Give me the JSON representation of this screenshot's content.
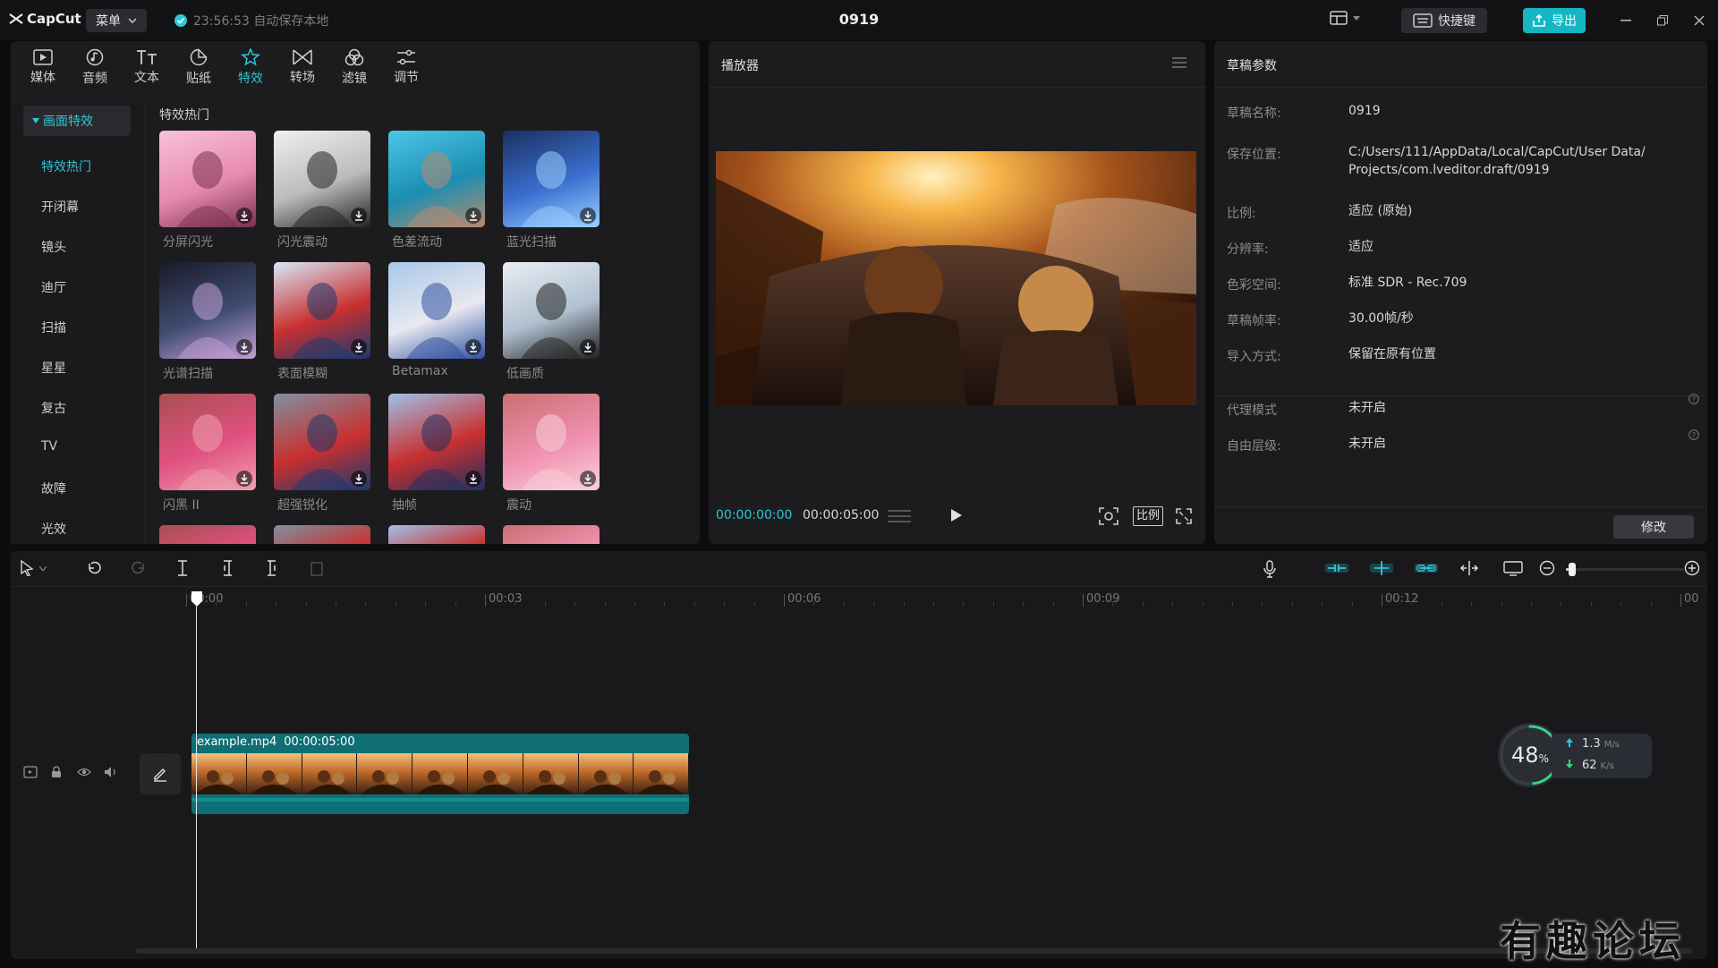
{
  "titlebar": {
    "app_name": "CapCut",
    "menu_label": "菜单",
    "autosave_text": "23:56:53 自动保存本地",
    "doc_title": "0919",
    "shortcut_label": "快捷键",
    "export_label": "导出"
  },
  "toolbar": [
    {
      "label": "媒体",
      "icon": "media-icon"
    },
    {
      "label": "音频",
      "icon": "audio-icon"
    },
    {
      "label": "文本",
      "icon": "text-icon"
    },
    {
      "label": "贴纸",
      "icon": "sticker-icon"
    },
    {
      "label": "特效",
      "icon": "effects-icon",
      "active": true
    },
    {
      "label": "转场",
      "icon": "transition-icon"
    },
    {
      "label": "滤镜",
      "icon": "filter-icon"
    },
    {
      "label": "调节",
      "icon": "adjust-icon"
    }
  ],
  "categories": {
    "header": "画面特效",
    "items": [
      "特效热门",
      "开闭幕",
      "镜头",
      "迪厅",
      "扫描",
      "星星",
      "复古",
      "TV",
      "故障",
      "光效"
    ]
  },
  "effects": {
    "section_title": "特效热门",
    "items": [
      {
        "label": "分屏闪光"
      },
      {
        "label": "闪光震动"
      },
      {
        "label": "色差流动"
      },
      {
        "label": "蓝光扫描"
      },
      {
        "label": "光谱扫描"
      },
      {
        "label": "表面模糊"
      },
      {
        "label": "Betamax"
      },
      {
        "label": "低画质"
      },
      {
        "label": "闪黑 II"
      },
      {
        "label": "超强锐化"
      },
      {
        "label": "抽帧"
      },
      {
        "label": "震动"
      }
    ]
  },
  "player": {
    "title": "播放器",
    "current_time": "00:00:00:00",
    "total_time": "00:00:05:00",
    "ratio_label": "比例"
  },
  "params": {
    "title": "草稿参数",
    "rows": [
      {
        "label": "草稿名称:",
        "value": "0919"
      },
      {
        "label": "保存位置:",
        "value": "C:/Users/111/AppData/Local/CapCut/User Data/",
        "value2": "Projects/com.lveditor.draft/0919"
      },
      {
        "label": "比例:",
        "value": "适应 (原始)"
      },
      {
        "label": "分辨率:",
        "value": "适应"
      },
      {
        "label": "色彩空间:",
        "value": "标准 SDR - Rec.709"
      },
      {
        "label": "草稿帧率:",
        "value": "30.00帧/秒"
      },
      {
        "label": "导入方式:",
        "value": "保留在原有位置"
      },
      {
        "label": "代理模式",
        "value": "未开启"
      },
      {
        "label": "自由层级:",
        "value": "未开启"
      }
    ],
    "modify_label": "修改"
  },
  "timeline": {
    "ruler": [
      "00:00",
      "00:03",
      "00:06",
      "00:09",
      "00:12",
      "00"
    ],
    "clip_name": "example.mp4",
    "clip_duration": "00:00:05:00",
    "zoom_level": 0.02
  },
  "net_widget": {
    "percent": "48",
    "percent_unit": "%",
    "up_value": "1.3",
    "up_unit": "M/s",
    "down_value": "62",
    "down_unit": "K/s"
  },
  "watermark": "有趣论坛",
  "colors": {
    "accent": "#2fc6d6",
    "export": "#14b6c4",
    "clip": "#0f6e74"
  }
}
